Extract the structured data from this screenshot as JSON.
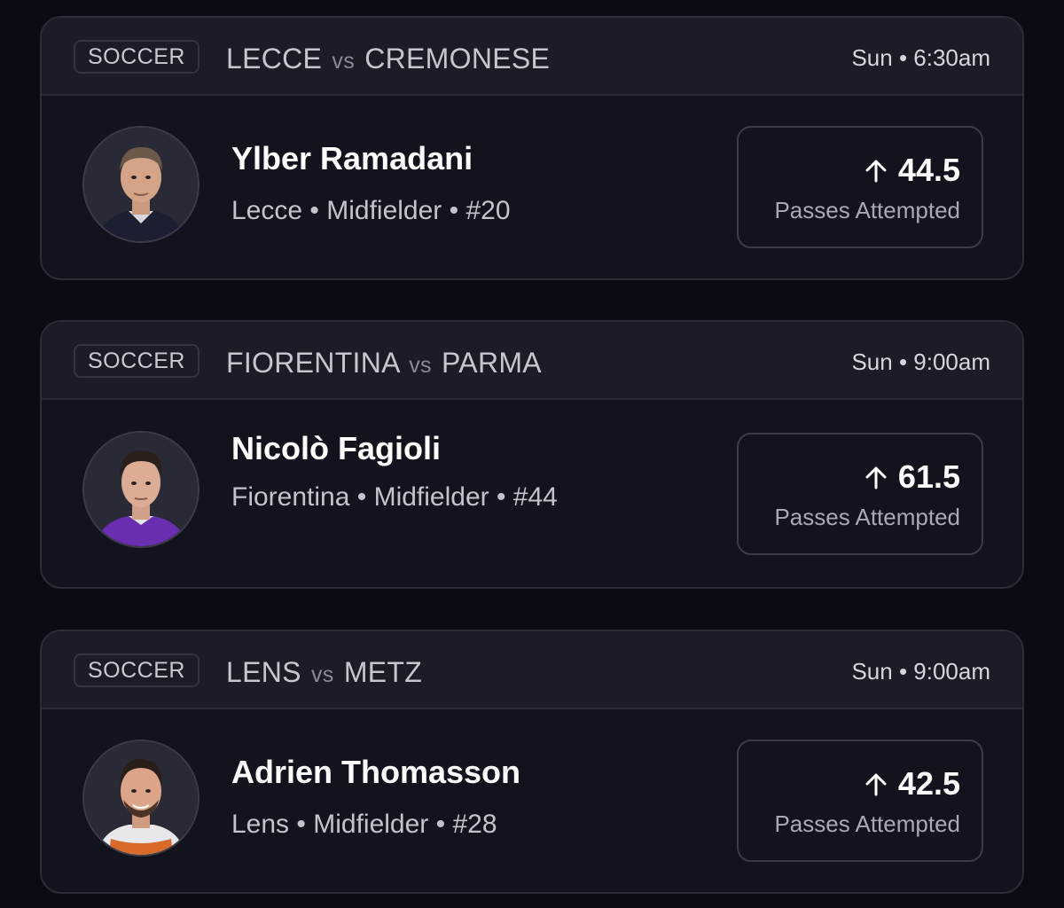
{
  "cards": [
    {
      "sport": "SOCCER",
      "home": "LECCE",
      "vs": "vs",
      "away": "CREMONESE",
      "time": "Sun • 6:30am",
      "player": {
        "name": "Ylber Ramadani",
        "info": "Lecce • Midfielder • #20",
        "avatar": "player-photo"
      },
      "prop": {
        "direction_icon": "arrow-up-icon",
        "value": "44.5",
        "stat": "Passes Attempted"
      }
    },
    {
      "sport": "SOCCER",
      "home": "FIORENTINA",
      "vs": "vs",
      "away": "PARMA",
      "time": "Sun • 9:00am",
      "player": {
        "name": "Nicolò Fagioli",
        "info": "Fiorentina • Midfielder • #44",
        "avatar": "player-photo"
      },
      "prop": {
        "direction_icon": "arrow-up-icon",
        "value": "61.5",
        "stat": "Passes Attempted"
      }
    },
    {
      "sport": "SOCCER",
      "home": "LENS",
      "vs": "vs",
      "away": "METZ",
      "time": "Sun • 9:00am",
      "player": {
        "name": "Adrien Thomasson",
        "info": "Lens • Midfielder • #28",
        "avatar": "player-photo"
      },
      "prop": {
        "direction_icon": "arrow-up-icon",
        "value": "42.5",
        "stat": "Passes Attempted"
      }
    }
  ]
}
